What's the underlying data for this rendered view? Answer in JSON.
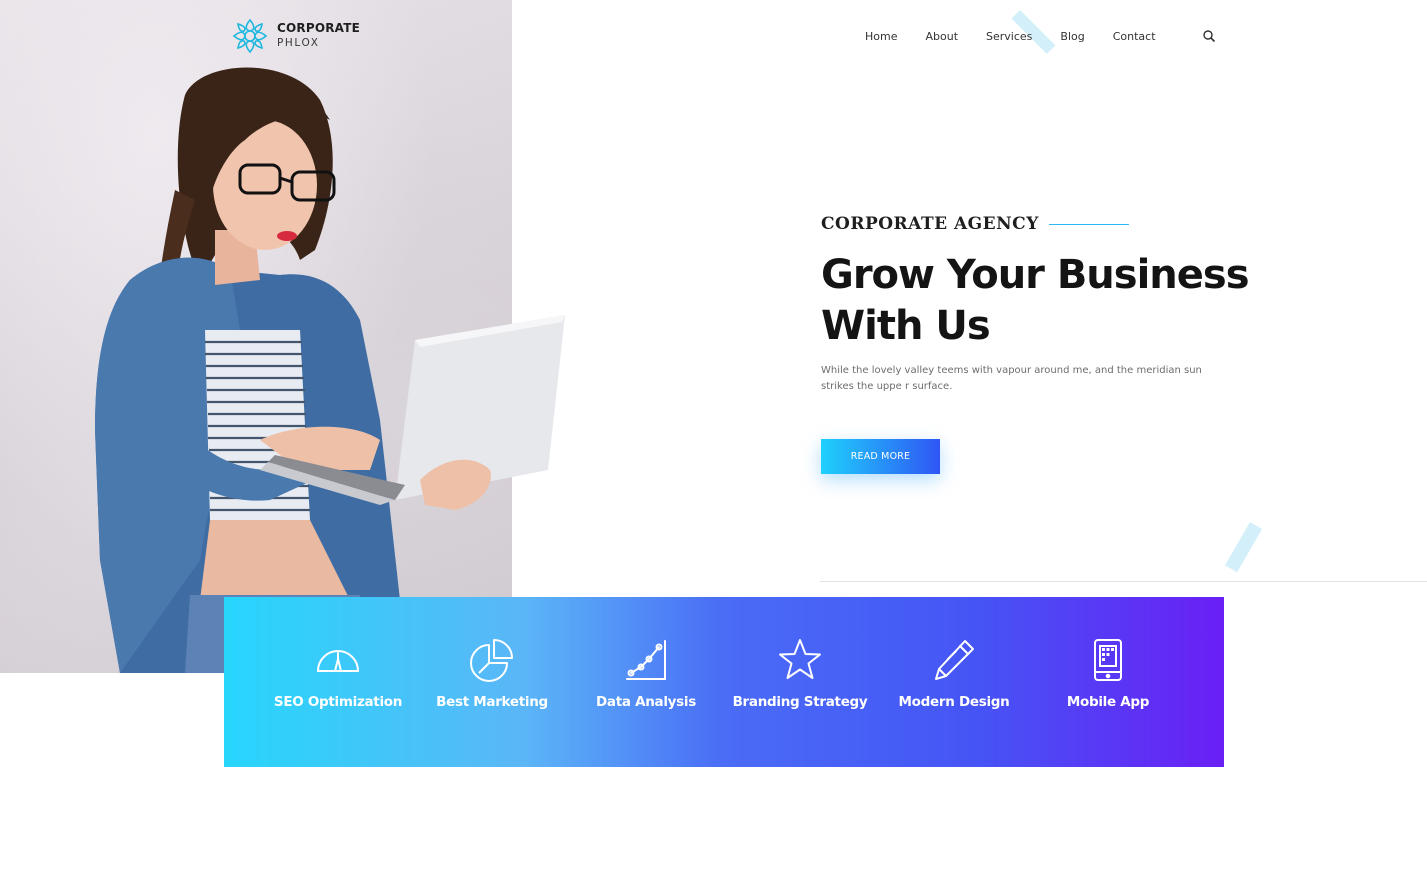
{
  "logo": {
    "line1": "CORPORATE",
    "line2": "PHLOX",
    "icon": "flower-logo-icon"
  },
  "nav": {
    "items": [
      "Home",
      "About",
      "Services",
      "Blog",
      "Contact"
    ],
    "search_icon": "search-icon"
  },
  "hero": {
    "eyebrow": "CORPORATE AGENCY",
    "headline_line1": "Grow Your Business",
    "headline_line2": "With Us",
    "paragraph_line1": "While the lovely valley teems with vapour around me, and the meridian sun",
    "paragraph_line2": "strikes the uppe r surface.",
    "button_label": "READ MORE"
  },
  "services": [
    {
      "label": "SEO Optimization",
      "icon": "speedometer-icon"
    },
    {
      "label": "Best Marketing",
      "icon": "pie-chart-icon"
    },
    {
      "label": "Data Analysis",
      "icon": "line-graph-icon"
    },
    {
      "label": "Branding Strategy",
      "icon": "star-icon"
    },
    {
      "label": "Modern Design",
      "icon": "pen-icon"
    },
    {
      "label": "Mobile App",
      "icon": "tablet-icon"
    }
  ],
  "colors": {
    "accent_cyan": "#27d6fc",
    "accent_blue": "#2f56f5",
    "accent_purple": "#6a1ff5",
    "heading": "#141414",
    "body_text": "#6d6d6d"
  }
}
